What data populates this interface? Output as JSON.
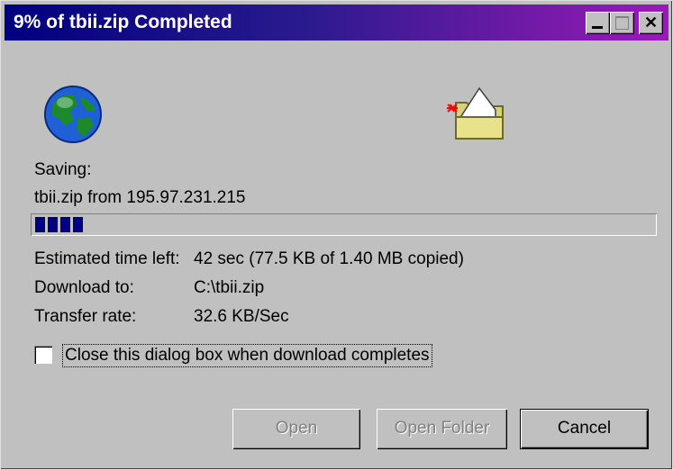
{
  "window": {
    "title": "9% of tbii.zip Completed",
    "minimize_label": "_",
    "maximize_label": "□",
    "close_label": "✕"
  },
  "icons": {
    "globe": "globe-icon",
    "folder": "folder-icon"
  },
  "status": {
    "saving_label": "Saving:",
    "source": "tbii.zip from 195.97.231.215",
    "progress_percent": 9,
    "estimated_label": "Estimated time left:",
    "estimated_value": "42 sec (77.5 KB of 1.40 MB copied)",
    "download_to_label": "Download to:",
    "download_to_value": "C:\\tbii.zip",
    "transfer_rate_label": "Transfer rate:",
    "transfer_rate_value": "32.6 KB/Sec"
  },
  "options": {
    "close_when_done_label": "Close this dialog box when download completes",
    "close_when_done_checked": false
  },
  "buttons": {
    "open": "Open",
    "open_folder": "Open Folder",
    "cancel": "Cancel"
  },
  "colors": {
    "title_gradient_start": "#000080",
    "title_gradient_end": "#9b1ab8",
    "progress_fill": "#000080",
    "face": "#c0c0c0"
  }
}
